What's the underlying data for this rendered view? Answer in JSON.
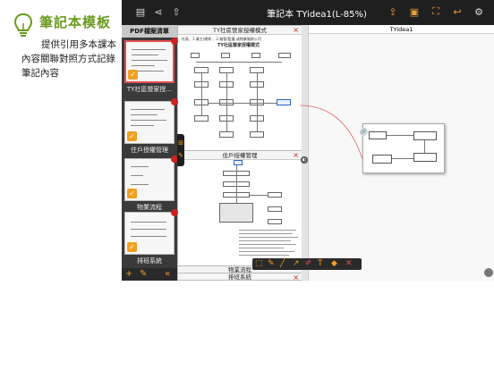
{
  "hero": {
    "title": "筆記本模板",
    "lines": [
      "提供引用多本課本",
      "內容關聯對照方式記錄",
      "筆記內容"
    ]
  },
  "topbar": {
    "title": "筆記本 TYidea1(L-85%)",
    "icons_left": [
      "notebook-icon",
      "share-icon",
      "up-arrow-icon"
    ],
    "icons_right": [
      "export-icon",
      "image-icon",
      "fullscreen-icon",
      "back-icon",
      "settings-icon"
    ]
  },
  "drawer": {
    "header": "PDF檔案清單",
    "items": [
      {
        "label": "TY社區營家授...",
        "selected": true
      },
      {
        "label": "住戶授權管理",
        "selected": false
      },
      {
        "label": "物業流程",
        "selected": false
      },
      {
        "label": "排班系統",
        "selected": false
      }
    ],
    "bottom_icons": [
      "add-icon",
      "edit-icon",
      "collapse-icon"
    ]
  },
  "panes": {
    "top_title": "TY社區營家授權模式",
    "doc_heading": "TY社區營家授權模式",
    "doc_subtitle": "社區、1.業主/建商 、2.營管/監護 或物業服務公司",
    "middle_title": "住戶授權管理",
    "bottom_title_1": "物業流程",
    "bottom_title_2": "排班系統",
    "close_label": "×"
  },
  "right_pane": {
    "title": "TYidea1"
  },
  "colors": {
    "accent": "#f0a020",
    "hero_title": "#6a9a1e",
    "topbar_bg": "#1f1f1f",
    "close": "#cc2222"
  }
}
